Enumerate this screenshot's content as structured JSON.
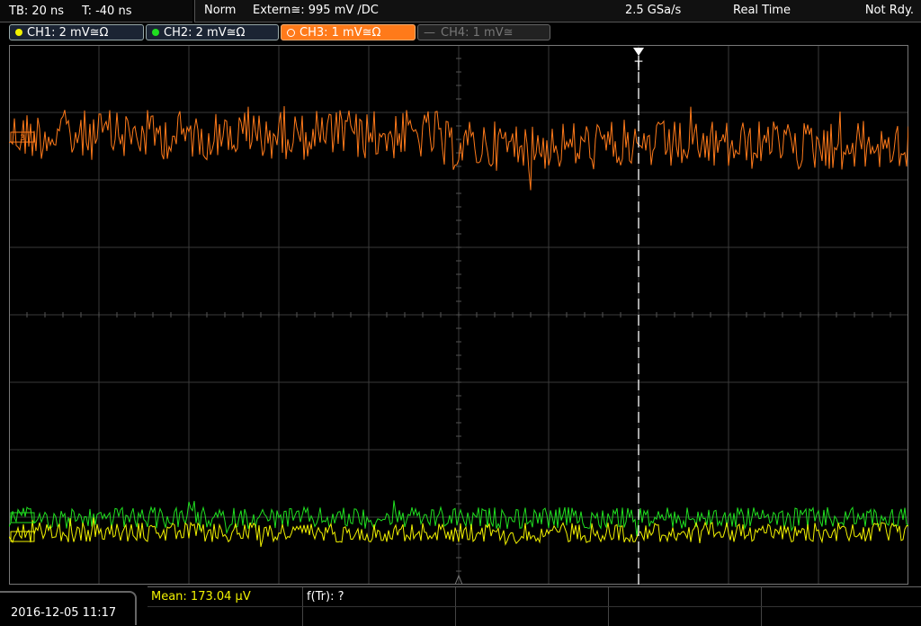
{
  "timebase": {
    "tb": "TB: 20 ns",
    "t": "T: -40 ns"
  },
  "status": {
    "mode": "Norm",
    "trigger": "Extern≅: 995 mV ∕DC",
    "sample_rate": "2.5 GSa/s",
    "acq": "Real Time",
    "state": "Not Rdy."
  },
  "channels": [
    {
      "label": "CH1: 2 mV≅Ω",
      "color": "#f2f200",
      "active": false
    },
    {
      "label": "CH2: 2 mV≅Ω",
      "color": "#20e020",
      "active": false
    },
    {
      "label": "CH3: 1 mV≅Ω",
      "color": "#ff7a1a",
      "active": true
    },
    {
      "label": "CH4: 1 mV≅",
      "color": "#666666",
      "active": false,
      "disabled": true
    }
  ],
  "markers": {
    "trigger": "T",
    "ch3_tag": "3"
  },
  "datetime": "2016-12-05 11:17",
  "measurements": {
    "mean": "Mean: 173.04 µV",
    "freq": "f(Tr): ?"
  },
  "colors": {
    "ch1": "#f2f200",
    "ch2": "#20e020",
    "ch3": "#ff7a1a",
    "grid": "#3a3a3a"
  }
}
